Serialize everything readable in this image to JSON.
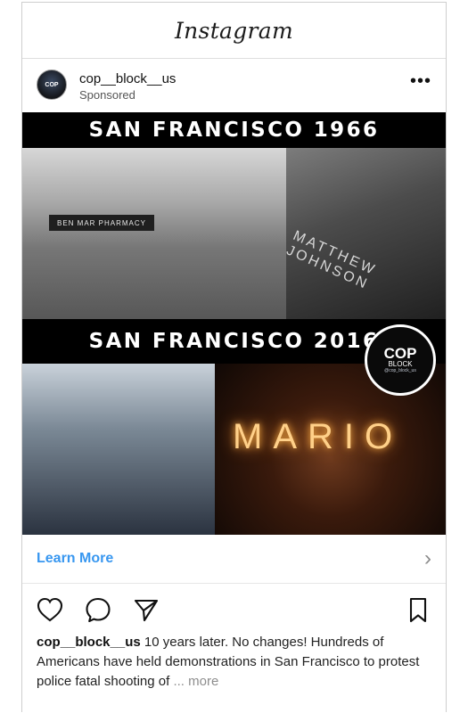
{
  "app": {
    "title": "Instagram"
  },
  "post": {
    "account": "cop__block__us",
    "sponsored_label": "Sponsored",
    "menu_icon": "more-horizontal-icon",
    "banner_top": "SAN FRANCISCO 1966",
    "banner_bottom": "SAN FRANCISCO 2016",
    "badge_title": "COP",
    "badge_sub": "BLOCK",
    "badge_handle": "@cop_block_us",
    "photo_text_1": "BEN MAR PHARMACY",
    "photo_text_2": "MATTHEW JOHNSON",
    "photo_text_3": "MARIO",
    "learn_more": "Learn More",
    "caption_user": "cop__block__us",
    "caption_text": " 10 years later. No changes! Hundreds of Americans have held demonstrations in San Francisco to protest police fatal shooting of",
    "caption_ellipsis": " ...",
    "caption_more": " more"
  },
  "icons": {
    "heart": "heart-icon",
    "comment": "comment-icon",
    "share": "share-icon",
    "save": "bookmark-icon",
    "chevron": "chevron-right-icon"
  },
  "colors": {
    "link_blue": "#3897f0",
    "text_dark": "#111111",
    "text_muted": "#8e8e8e"
  }
}
